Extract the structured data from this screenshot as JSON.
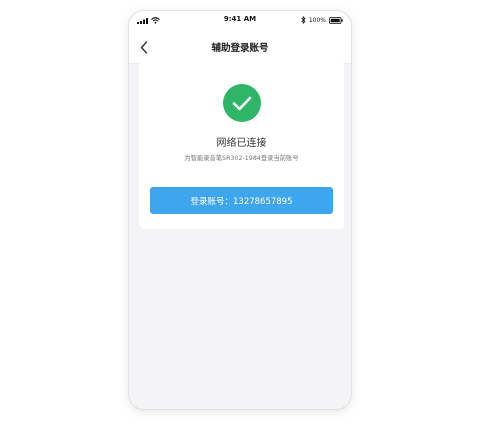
{
  "status_bar": {
    "time": "9:41 AM",
    "battery": "100%"
  },
  "nav": {
    "title": "辅助登录账号"
  },
  "card": {
    "status_title": "网络已连接",
    "status_subtitle": "为智能录音笔SR302-1984登录当前账号",
    "login_button": "登录账号：13278657895"
  },
  "colors": {
    "success": "#2eb568",
    "primary_button": "#3ea6ef"
  },
  "icons": [
    "signal-icon",
    "wifi-icon",
    "bluetooth-icon",
    "battery-icon",
    "back-arrow-icon",
    "check-icon"
  ]
}
